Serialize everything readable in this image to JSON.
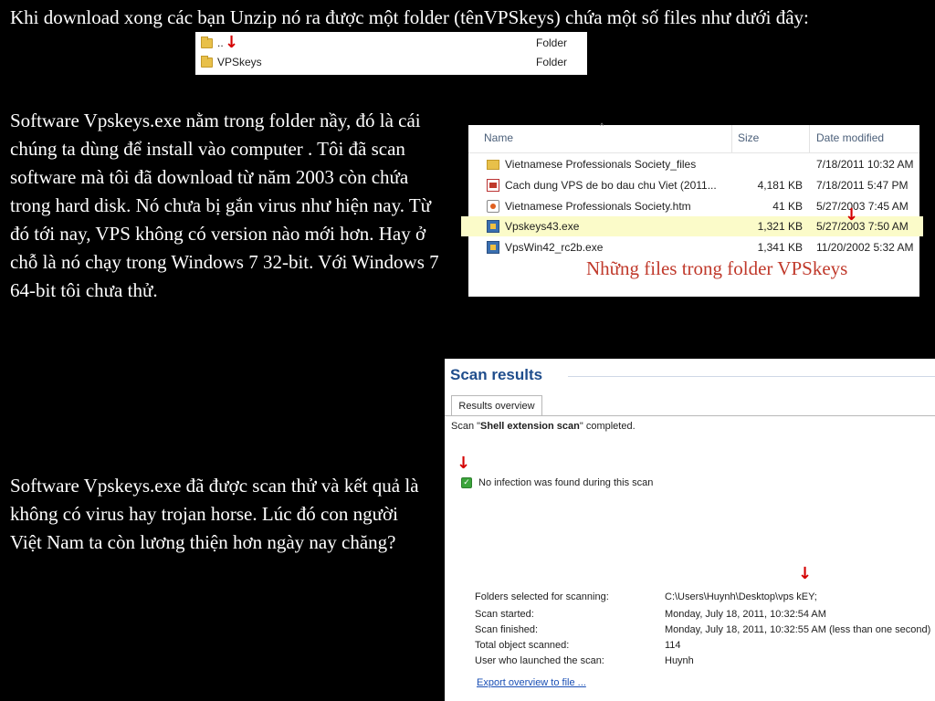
{
  "intro_text": "Khi download xong các bạn Unzip nó ra được một folder (tênVPSkeys) chứa một số files như dưới đây:",
  "paragraph_1": "Software Vpskeys.exe nằm trong folder nầy, đó là cái chúng ta dùng để install vào computer . Tôi đã scan software mà tôi đã download từ năm 2003 còn chứa trong hard disk. Nó chưa bị gắn virus như hiện nay. Từ đó tới nay, VPS không có version nào mới hơn. Hay ở chỗ là nó chạy trong Windows 7 32-bit. Với Windows 7 64-bit tôi chưa thử.",
  "paragraph_2": "Software Vpskeys.exe đã được scan thử và kết quả là không có virus hay trojan horse. Lúc đó con người Việt Nam ta còn lương thiện hơn ngày nay chăng?",
  "folder_snippet": {
    "rows": [
      {
        "name": "..",
        "type": "Folder",
        "icon": "folder-icon"
      },
      {
        "name": "VPSkeys",
        "type": "Folder",
        "icon": "folder-icon"
      }
    ]
  },
  "explorer": {
    "columns": {
      "name": "Name",
      "size": "Size",
      "date": "Date modified"
    },
    "rows": [
      {
        "name": "Vietnamese Professionals Society_files",
        "size": "",
        "date": "7/18/2011 10:32 AM",
        "icon": "folder-icon"
      },
      {
        "name": "Cach dung VPS de bo dau chu Viet (2011...",
        "size": "4,181 KB",
        "date": "7/18/2011 5:47 PM",
        "icon": "pdf-icon"
      },
      {
        "name": "Vietnamese Professionals Society.htm",
        "size": "41 KB",
        "date": "5/27/2003 7:45 AM",
        "icon": "html-file-icon"
      },
      {
        "name": "Vpskeys43.exe",
        "size": "1,321 KB",
        "date": "5/27/2003 7:50 AM",
        "icon": "exe-icon",
        "highlighted": true
      },
      {
        "name": "VpsWin42_rc2b.exe",
        "size": "1,341 KB",
        "date": "11/20/2002 5:32 AM",
        "icon": "exe-icon"
      }
    ],
    "caption": "Những files trong folder VPSkeys"
  },
  "scan": {
    "title": "Scan results",
    "tab": "Results overview",
    "status_prefix": "Scan \"",
    "status_name": "Shell extension scan",
    "status_suffix": "\" completed.",
    "result": "No infection was found during this scan",
    "details": [
      {
        "label": "Folders selected for scanning:",
        "value": "C:\\Users\\Huynh\\Desktop\\vps kEY;"
      },
      {
        "label": "Scan started:",
        "value": "Monday, July 18, 2011, 10:32:54 AM"
      },
      {
        "label": "Scan finished:",
        "value": "Monday, July 18, 2011, 10:32:55 AM (less than one second)"
      },
      {
        "label": "Total object scanned:",
        "value": "114"
      },
      {
        "label": "User who launched the scan:",
        "value": "Huynh"
      }
    ],
    "export_link": "Export overview to file ..."
  },
  "arrow_glyph": "↓",
  "colors": {
    "annotation_red": "#d40000",
    "caption_red": "#c0392b",
    "highlight": "#fbfbc9",
    "title_blue": "#1f4d8c"
  }
}
